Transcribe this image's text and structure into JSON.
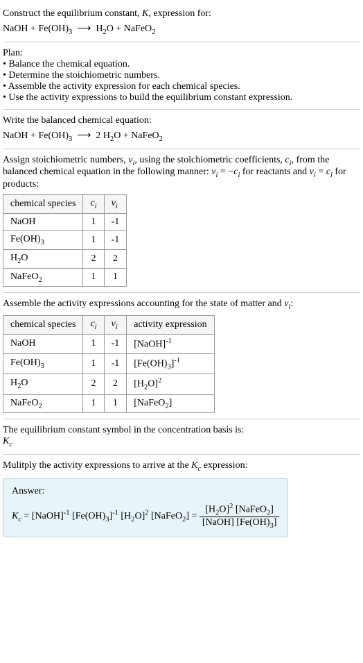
{
  "prompt": {
    "line1": "Construct the equilibrium constant, K, expression for:",
    "eq": "NaOH + Fe(OH)₃  ⟶  H₂O + NaFeO₂"
  },
  "plan": {
    "heading": "Plan:",
    "items": [
      "• Balance the chemical equation.",
      "• Determine the stoichiometric numbers.",
      "• Assemble the activity expression for each chemical species.",
      "• Use the activity expressions to build the equilibrium constant expression."
    ]
  },
  "balanced": {
    "heading": "Write the balanced chemical equation:",
    "eq": "NaOH + Fe(OH)₃  ⟶  2 H₂O + NaFeO₂"
  },
  "stoich": {
    "intro_a": "Assign stoichiometric numbers, νᵢ, using the stoichiometric coefficients, cᵢ, from the balanced chemical equation in the following manner: νᵢ = −cᵢ for reactants and νᵢ = cᵢ for products:",
    "headers": [
      "chemical species",
      "cᵢ",
      "νᵢ"
    ],
    "rows": [
      {
        "species": "NaOH",
        "c": "1",
        "v": "-1"
      },
      {
        "species": "Fe(OH)₃",
        "c": "1",
        "v": "-1"
      },
      {
        "species": "H₂O",
        "c": "2",
        "v": "2"
      },
      {
        "species": "NaFeO₂",
        "c": "1",
        "v": "1"
      }
    ]
  },
  "activity": {
    "intro": "Assemble the activity expressions accounting for the state of matter and νᵢ:",
    "headers": [
      "chemical species",
      "cᵢ",
      "νᵢ",
      "activity expression"
    ],
    "rows": [
      {
        "species": "NaOH",
        "c": "1",
        "v": "-1",
        "expr": "[NaOH]⁻¹"
      },
      {
        "species": "Fe(OH)₃",
        "c": "1",
        "v": "-1",
        "expr": "[Fe(OH)₃]⁻¹"
      },
      {
        "species": "H₂O",
        "c": "2",
        "v": "2",
        "expr": "[H₂O]²"
      },
      {
        "species": "NaFeO₂",
        "c": "1",
        "v": "1",
        "expr": "[NaFeO₂]"
      }
    ]
  },
  "symbol": {
    "line1": "The equilibrium constant symbol in the concentration basis is:",
    "line2": "K_c"
  },
  "multiply": {
    "heading": "Mulitply the activity expressions to arrive at the K_c expression:"
  },
  "answer": {
    "label": "Answer:",
    "lhs": "K_c = [NaOH]⁻¹ [Fe(OH)₃]⁻¹ [H₂O]² [NaFeO₂] = ",
    "num": "[H₂O]² [NaFeO₂]",
    "den": "[NaOH] [Fe(OH)₃]"
  }
}
